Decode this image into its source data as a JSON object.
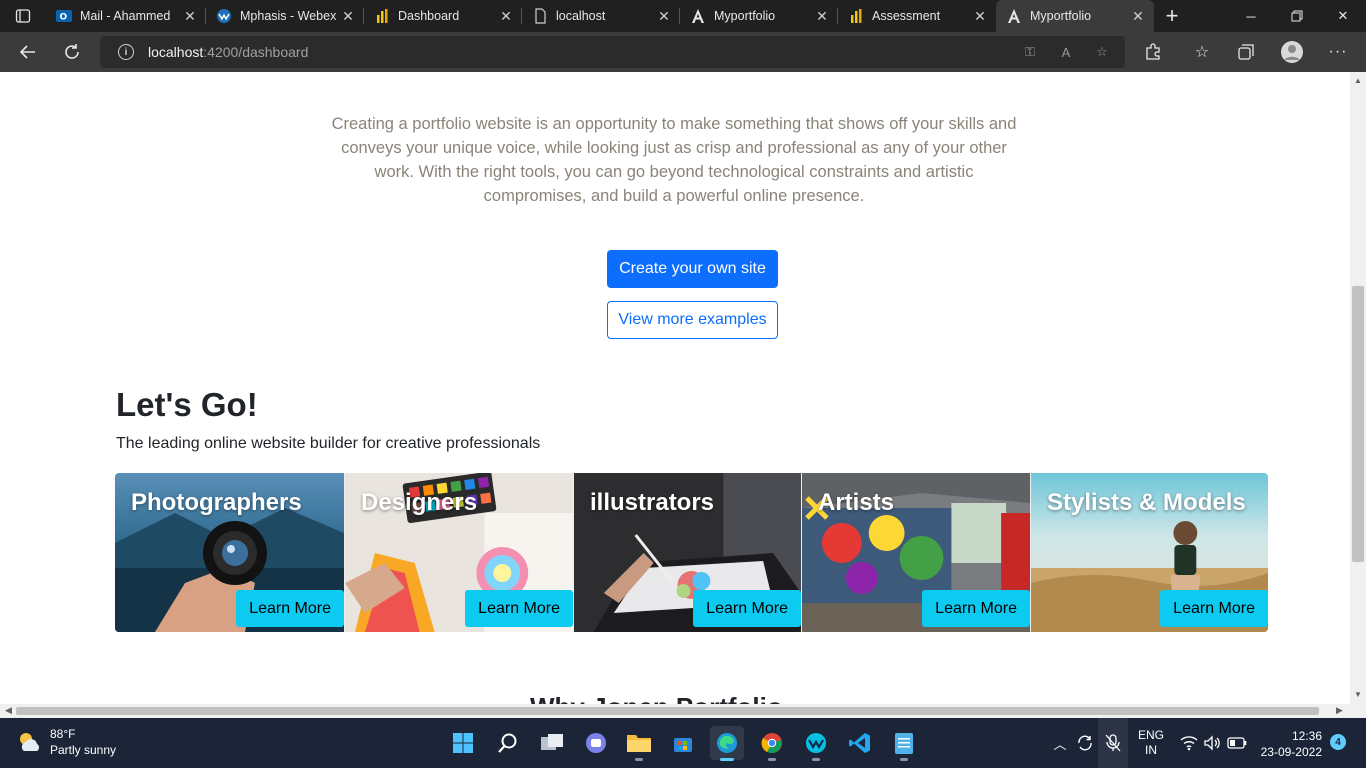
{
  "browser": {
    "tabs": [
      {
        "title": "Mail - Ahammed",
        "icon": "outlook-icon"
      },
      {
        "title": "Mphasis - Webex",
        "icon": "webex-icon"
      },
      {
        "title": "Dashboard",
        "icon": "powerbi-icon"
      },
      {
        "title": "localhost",
        "icon": "page-icon"
      },
      {
        "title": "Myportfolio",
        "icon": "angular-icon"
      },
      {
        "title": "Assessment",
        "icon": "powerbi-icon"
      },
      {
        "title": "Myportfolio",
        "icon": "angular-icon",
        "active": true
      }
    ],
    "address": {
      "host": "localhost",
      "path": ":4200/dashboard"
    }
  },
  "page": {
    "intro": "Creating a portfolio website is an opportunity to make something that shows off your skills and conveys your unique voice, while looking just as crisp and professional as any of your other work. With the right tools, you can go beyond technological constraints and artistic compromises, and build a powerful online presence.",
    "primary_button": "Create your own site",
    "secondary_button": "View more examples",
    "heading": "Let's Go!",
    "subheading": "The leading online website builder for creative professionals",
    "cards": [
      {
        "title": "Photographers",
        "button": "Learn More"
      },
      {
        "title": "Designers",
        "button": "Learn More"
      },
      {
        "title": "illustrators",
        "button": "Learn More"
      },
      {
        "title": "Artists",
        "button": "Learn More"
      },
      {
        "title": "Stylists & Models",
        "button": "Learn More"
      }
    ],
    "next_heading_peek": "Why Jonen Portfolio"
  },
  "taskbar": {
    "weather": {
      "temp": "88°F",
      "condition": "Partly sunny"
    },
    "apps": [
      "windows-start-icon",
      "search-icon",
      "task-view-icon",
      "teams-chat-icon",
      "file-explorer-icon",
      "store-icon",
      "edge-icon",
      "chrome-icon",
      "webex-icon",
      "vscode-icon",
      "notepad-icon"
    ],
    "language": {
      "line1": "ENG",
      "line2": "IN"
    },
    "clock": {
      "time": "12:36",
      "date": "23-09-2022"
    },
    "notifications": "4"
  },
  "colors": {
    "primary": "#0d6efd",
    "info": "#0dcaf0",
    "intro_text": "#8a8478"
  }
}
